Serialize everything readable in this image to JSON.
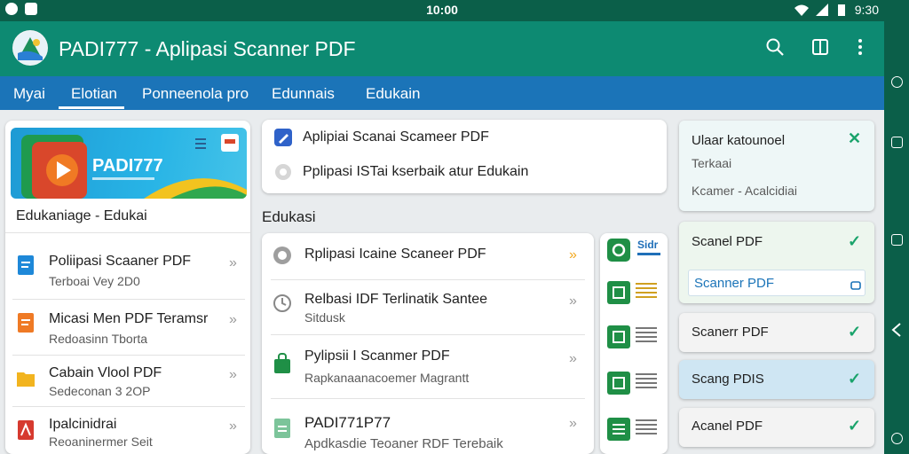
{
  "status_bar": {
    "time": "10:00",
    "right_time": "9:30"
  },
  "app_bar": {
    "title": "PADI777 - Aplipasi Scanner PDF",
    "icons": [
      "search-icon",
      "book-icon",
      "more-vert-icon"
    ]
  },
  "tabs": [
    {
      "label": "Myai",
      "active": false
    },
    {
      "label": "Elotian",
      "active": true
    },
    {
      "label": "Ponneenola pro",
      "active": false
    },
    {
      "label": "Edunnais",
      "active": false
    },
    {
      "label": "Edukain",
      "active": false
    }
  ],
  "left_panel": {
    "banner_title": "PADI777",
    "heading": "Edukaniage - Edukai",
    "items": [
      {
        "title": "Poliipasi Scaaner PDF",
        "subtitle": "Terboai Vey 2D0",
        "icon": "doc-blue-icon"
      },
      {
        "title": "Micasi Men PDF Teramsr",
        "subtitle": "Redoasinn Tborta",
        "icon": "doc-orange-icon"
      },
      {
        "title": "Cabain Vlool PDF",
        "subtitle": "Sedeconan 3 2OP",
        "icon": "folder-yellow-icon"
      },
      {
        "title": "Ipalcinidrai",
        "subtitle": "Reoaninermer Seit",
        "icon": "pdf-red-icon"
      }
    ]
  },
  "top_card": {
    "lines": [
      {
        "text": "Aplipiai Scanai Scameer PDF",
        "icon": "pen-icon"
      },
      {
        "text": "Pplipasi ISTai kserbaik atur Edukain",
        "icon": "circle-icon"
      }
    ]
  },
  "section_title": "Edukasi",
  "middle_list": [
    {
      "title": "Rplipasi Icaine Scaneer PDF",
      "subtitle": "",
      "icon": "scan-gray-icon",
      "chevron": "»"
    },
    {
      "title": "Relbasi IDF Terlinatik Santee",
      "subtitle": "Sitdusk",
      "icon": "clock-icon",
      "chevron": "»"
    },
    {
      "title": "Pylipsii I Scanmer PDF",
      "subtitle": "Rapkanaanacoemer Magrantt",
      "icon": "lock-green-icon",
      "chevron": "»"
    },
    {
      "title": "PADI771P77",
      "subtitle": "Apdkasdie Teoaner RDF Terebaik",
      "icon": "doc-green-icon",
      "chevron": "»"
    }
  ],
  "thumb_column": [
    {
      "label": "Sidr"
    },
    {
      "label": ""
    },
    {
      "label": ""
    },
    {
      "label": ""
    },
    {
      "label": ""
    }
  ],
  "right_panel": {
    "header_card": {
      "title": "Ulaar katounoel",
      "line2": "Terkaai",
      "line3": "Kcamer - Acalcidiai"
    },
    "items": [
      {
        "label": "Scanel PDF",
        "sub_label": "Scanner PDF"
      },
      {
        "label": "Scanerr PDF"
      },
      {
        "label": "Scang PDIS"
      },
      {
        "label": "Acanel PDF"
      }
    ]
  },
  "colors": {
    "statusbar": "#0b5f49",
    "appbar": "#0d8a72",
    "tabbar": "#1b74b8",
    "accent_green": "#1aa36b"
  }
}
